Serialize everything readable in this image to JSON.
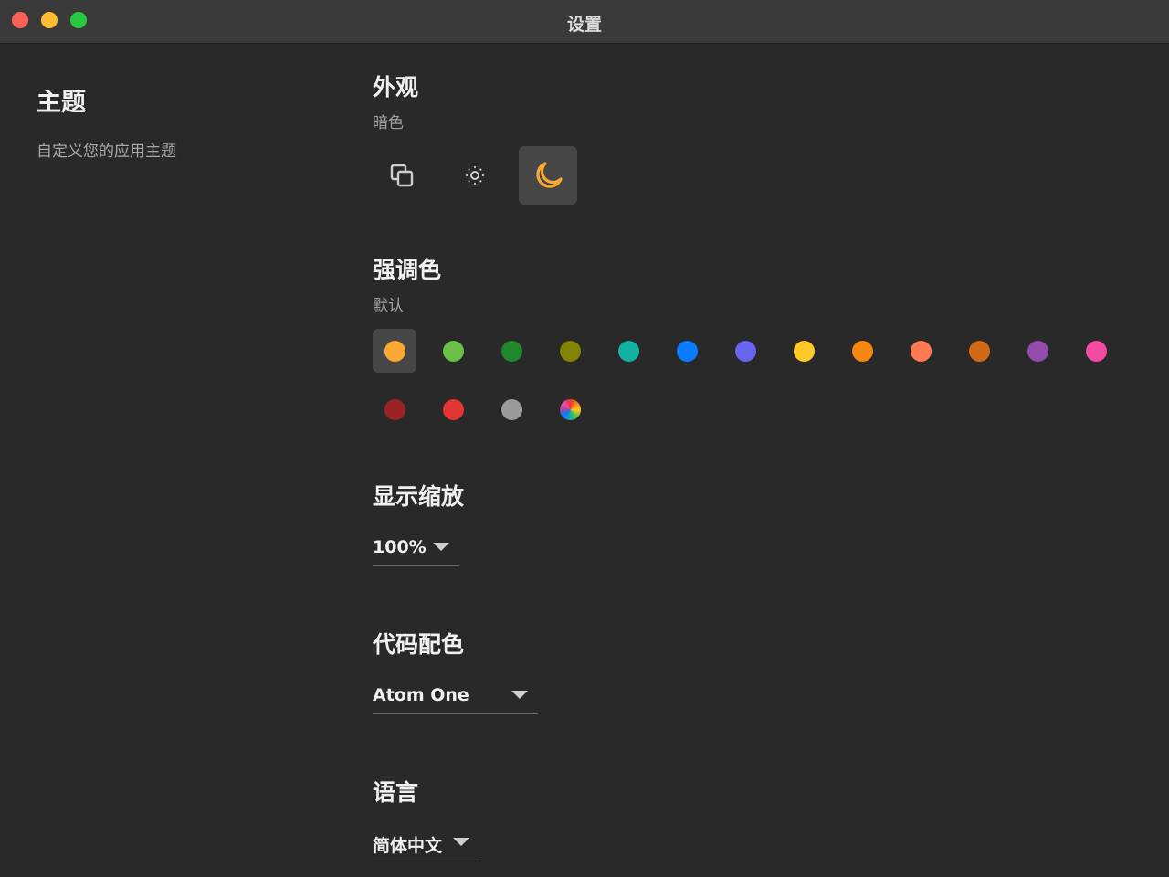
{
  "window": {
    "title": "设置"
  },
  "sidebar": {
    "heading": "主题",
    "description": "自定义您的应用主题"
  },
  "appearance": {
    "title": "外观",
    "current": "暗色",
    "modes": [
      {
        "icon": "copy-icon",
        "label": "auto"
      },
      {
        "icon": "sun-icon",
        "label": "light"
      },
      {
        "icon": "moon-icon",
        "label": "dark",
        "selected": true
      }
    ]
  },
  "accent": {
    "title": "强调色",
    "current": "默认",
    "colors": [
      "#f9a833",
      "#6ac046",
      "#20882a",
      "#828300",
      "#14b0a2",
      "#0a7aff",
      "#6965ef",
      "#ffc92a",
      "#f78512",
      "#ff7952",
      "#d06a18",
      "#944bac",
      "#f34ba2",
      "#9b2323",
      "#e43535",
      "#9a9a9a",
      "rainbow"
    ]
  },
  "zoom": {
    "title": "显示缩放",
    "value": "100%"
  },
  "code_theme": {
    "title": "代码配色",
    "value": "Atom One"
  },
  "language": {
    "title": "语言",
    "value": "简体中文"
  }
}
